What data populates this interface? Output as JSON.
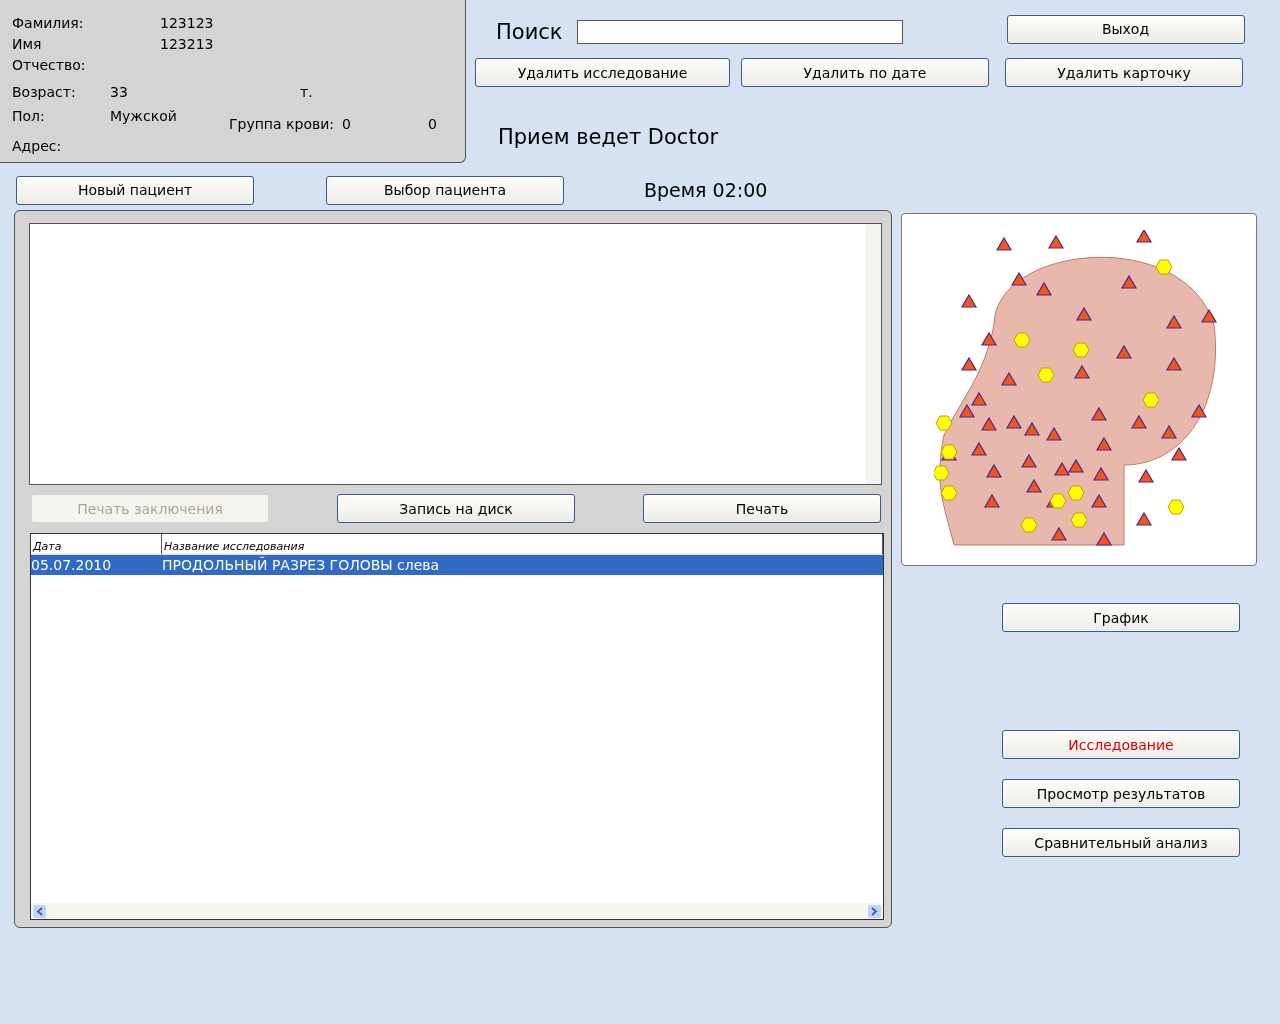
{
  "patient": {
    "fields": [
      {
        "label": "Фамилия:",
        "value": "123123"
      },
      {
        "label": "Имя",
        "value": "123213"
      },
      {
        "label": "Отчество:"
      }
    ],
    "age": {
      "label": "Возраст:",
      "value": "33",
      "unit": "т."
    },
    "sex": {
      "label": "Пол:",
      "value": "Мужской"
    },
    "blood": {
      "label": "Группа крови:",
      "value": "0",
      "extra": "0"
    },
    "address": {
      "label": "Адрес:"
    }
  },
  "search": {
    "label": "Поиск"
  },
  "exit_button": "Выход",
  "delete_buttons": [
    "Удалить исследование",
    "Удалить по дате",
    "Удалить карточку"
  ],
  "doctor_line": "Прием ведет Doctor",
  "patient_buttons": [
    "Новый пациент",
    "Выбор пациента"
  ],
  "time": "Время 02:00",
  "print_buttons": [
    {
      "label": "Печать заключения",
      "disabled": true
    },
    {
      "label": "Запись на диск",
      "disabled": false
    },
    {
      "label": "Печать",
      "disabled": false
    }
  ],
  "table": {
    "columns": [
      "Дата",
      "Название исследования"
    ],
    "rows": [
      {
        "cells": [
          "05.07.2010",
          "ПРОДОЛЬНЫЙ  РАЗРЕЗ  ГОЛОВЫ слева"
        ],
        "selected": true
      }
    ]
  },
  "side_buttons": [
    {
      "label": "График",
      "alert": false
    },
    {
      "label": "Исследование",
      "alert": true
    },
    {
      "label": "Просмотр результатов",
      "alert": false
    },
    {
      "label": "Сравнительный анализ",
      "alert": false
    }
  ]
}
